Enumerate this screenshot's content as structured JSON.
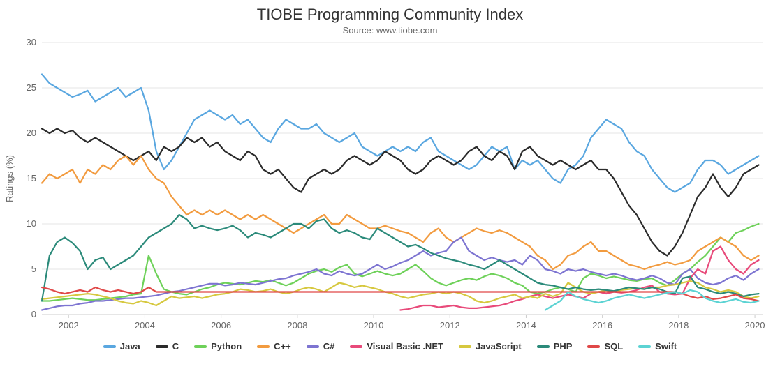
{
  "title": "TIOBE Programming Community Index",
  "subtitle": "Source: www.tiobe.com",
  "ylabel": "Ratings (%)",
  "chart_data": {
    "type": "line",
    "xlabel": "",
    "ylabel": "Ratings (%)",
    "ylim": [
      0,
      30
    ],
    "xlim": [
      2001.3,
      2020.2
    ],
    "xticks": [
      2002,
      2004,
      2006,
      2008,
      2010,
      2012,
      2014,
      2016,
      2018,
      2020
    ],
    "yticks": [
      0,
      5,
      10,
      15,
      20,
      25,
      30
    ],
    "x": [
      2001.3,
      2001.5,
      2001.7,
      2001.9,
      2002.1,
      2002.3,
      2002.5,
      2002.7,
      2002.9,
      2003.1,
      2003.3,
      2003.5,
      2003.7,
      2003.9,
      2004.1,
      2004.3,
      2004.5,
      2004.7,
      2004.9,
      2005.1,
      2005.3,
      2005.5,
      2005.7,
      2005.9,
      2006.1,
      2006.3,
      2006.5,
      2006.7,
      2006.9,
      2007.1,
      2007.3,
      2007.5,
      2007.7,
      2007.9,
      2008.1,
      2008.3,
      2008.5,
      2008.7,
      2008.9,
      2009.1,
      2009.3,
      2009.5,
      2009.7,
      2009.9,
      2010.1,
      2010.3,
      2010.5,
      2010.7,
      2010.9,
      2011.1,
      2011.3,
      2011.5,
      2011.7,
      2011.9,
      2012.1,
      2012.3,
      2012.5,
      2012.7,
      2012.9,
      2013.1,
      2013.3,
      2013.5,
      2013.7,
      2013.9,
      2014.1,
      2014.3,
      2014.5,
      2014.7,
      2014.9,
      2015.1,
      2015.3,
      2015.5,
      2015.7,
      2015.9,
      2016.1,
      2016.3,
      2016.5,
      2016.7,
      2016.9,
      2017.1,
      2017.3,
      2017.5,
      2017.7,
      2017.9,
      2018.1,
      2018.3,
      2018.5,
      2018.7,
      2018.9,
      2019.1,
      2019.3,
      2019.5,
      2019.7,
      2019.9,
      2020.1
    ],
    "series": [
      {
        "name": "Java",
        "color": "#5aa7e0",
        "values": [
          26.5,
          25.5,
          25.0,
          24.5,
          24.0,
          24.3,
          24.7,
          23.5,
          24.0,
          24.5,
          25.0,
          24.0,
          24.5,
          25.0,
          22.5,
          18.0,
          16.0,
          17.0,
          18.5,
          20.0,
          21.5,
          22.0,
          22.5,
          22.0,
          21.5,
          22.0,
          21.0,
          21.5,
          20.5,
          19.5,
          19.0,
          20.5,
          21.5,
          21.0,
          20.5,
          20.5,
          21.0,
          20.0,
          19.5,
          19.0,
          19.5,
          20.0,
          18.5,
          18.0,
          17.5,
          18.0,
          18.5,
          18.0,
          18.5,
          18.0,
          19.0,
          19.5,
          18.0,
          17.5,
          17.0,
          16.5,
          16.0,
          16.5,
          17.5,
          18.5,
          18.0,
          18.5,
          16.0,
          17.0,
          16.5,
          17.0,
          16.0,
          15.0,
          14.5,
          16.0,
          16.5,
          17.5,
          19.5,
          20.5,
          21.5,
          21.0,
          20.5,
          19.0,
          18.0,
          17.5,
          16.0,
          15.0,
          14.0,
          13.5,
          14.0,
          14.5,
          16.0,
          17.0,
          17.0,
          16.5,
          15.5,
          16.0,
          16.5,
          17.0,
          17.5
        ]
      },
      {
        "name": "C",
        "color": "#2b2b2b",
        "values": [
          20.5,
          20.0,
          20.5,
          20.0,
          20.3,
          19.5,
          19.0,
          19.5,
          19.0,
          18.5,
          18.0,
          17.5,
          17.0,
          17.5,
          18.0,
          17.0,
          18.5,
          18.0,
          18.5,
          19.5,
          19.0,
          19.5,
          18.5,
          19.0,
          18.0,
          17.5,
          17.0,
          18.0,
          17.5,
          16.0,
          15.5,
          16.0,
          15.0,
          14.0,
          13.5,
          15.0,
          15.5,
          16.0,
          15.5,
          16.0,
          17.0,
          17.5,
          17.0,
          16.5,
          17.0,
          18.0,
          17.5,
          17.0,
          16.0,
          15.5,
          16.0,
          17.0,
          17.5,
          17.0,
          16.5,
          17.0,
          18.0,
          18.5,
          17.5,
          17.0,
          18.0,
          17.5,
          16.0,
          18.0,
          18.5,
          17.5,
          17.0,
          16.5,
          17.0,
          16.5,
          16.0,
          16.5,
          17.0,
          16.0,
          16.0,
          15.0,
          13.5,
          12.0,
          11.0,
          9.5,
          8.0,
          7.0,
          6.5,
          7.5,
          9.0,
          11.0,
          13.0,
          14.0,
          15.5,
          14.0,
          13.0,
          14.0,
          15.5,
          16.0,
          16.5
        ]
      },
      {
        "name": "Python",
        "color": "#6ed159",
        "values": [
          1.5,
          1.5,
          1.6,
          1.7,
          1.8,
          1.7,
          1.6,
          1.6,
          1.7,
          1.8,
          1.9,
          2.0,
          2.2,
          2.3,
          6.5,
          4.5,
          2.8,
          2.5,
          2.3,
          2.2,
          2.5,
          2.8,
          3.0,
          3.3,
          3.5,
          3.4,
          3.3,
          3.5,
          3.7,
          3.6,
          3.8,
          3.5,
          3.2,
          3.5,
          4.0,
          4.5,
          4.8,
          5.0,
          4.7,
          5.2,
          5.5,
          4.5,
          4.2,
          4.5,
          4.8,
          4.5,
          4.3,
          4.5,
          5.0,
          5.5,
          4.8,
          4.0,
          3.5,
          3.2,
          3.5,
          3.8,
          4.0,
          3.8,
          4.2,
          4.5,
          4.3,
          4.0,
          3.5,
          3.2,
          2.5,
          2.3,
          2.5,
          2.8,
          3.0,
          2.8,
          2.5,
          4.0,
          4.5,
          4.3,
          4.0,
          4.2,
          4.0,
          3.8,
          3.7,
          3.9,
          4.0,
          3.5,
          3.2,
          3.8,
          4.5,
          5.0,
          5.8,
          6.5,
          7.5,
          8.5,
          8.0,
          9.0,
          9.3,
          9.7,
          10.0
        ]
      },
      {
        "name": "C++",
        "color": "#f29b3f",
        "values": [
          14.5,
          15.5,
          15.0,
          15.5,
          16.0,
          14.5,
          16.0,
          15.5,
          16.5,
          16.0,
          17.0,
          17.5,
          16.5,
          17.5,
          16.0,
          15.0,
          14.5,
          13.0,
          12.0,
          11.0,
          11.5,
          11.0,
          11.5,
          11.0,
          11.5,
          11.0,
          10.5,
          11.0,
          10.5,
          11.0,
          10.5,
          10.0,
          9.5,
          9.0,
          9.5,
          10.0,
          10.5,
          11.0,
          10.0,
          10.0,
          11.0,
          10.5,
          10.0,
          9.5,
          9.5,
          9.8,
          9.5,
          9.2,
          9.0,
          8.5,
          8.0,
          9.0,
          9.5,
          8.5,
          8.0,
          8.5,
          9.0,
          9.5,
          9.2,
          9.0,
          9.3,
          9.0,
          8.5,
          8.0,
          7.5,
          6.5,
          6.0,
          5.0,
          5.5,
          6.5,
          6.8,
          7.5,
          8.0,
          7.0,
          7.0,
          6.5,
          6.0,
          5.5,
          5.3,
          5.0,
          5.3,
          5.5,
          5.8,
          5.5,
          5.7,
          6.0,
          7.0,
          7.5,
          8.0,
          8.5,
          8.0,
          7.5,
          6.5,
          6.0,
          6.5
        ]
      },
      {
        "name": "C#",
        "color": "#7d74d1",
        "values": [
          0.5,
          0.7,
          0.9,
          1.0,
          1.0,
          1.2,
          1.3,
          1.5,
          1.5,
          1.6,
          1.7,
          1.8,
          1.8,
          1.9,
          2.0,
          2.1,
          2.3,
          2.5,
          2.6,
          2.8,
          3.0,
          3.2,
          3.4,
          3.4,
          3.2,
          3.3,
          3.5,
          3.4,
          3.3,
          3.5,
          3.7,
          3.9,
          4.0,
          4.3,
          4.5,
          4.7,
          5.0,
          4.5,
          4.3,
          4.8,
          4.5,
          4.3,
          4.5,
          5.0,
          5.5,
          5.0,
          5.3,
          5.7,
          6.0,
          6.5,
          7.0,
          6.5,
          6.8,
          7.0,
          8.0,
          8.5,
          7.0,
          6.5,
          6.0,
          6.3,
          6.0,
          5.8,
          6.0,
          5.5,
          6.5,
          6.0,
          5.0,
          4.8,
          4.5,
          5.0,
          4.8,
          5.0,
          4.7,
          4.5,
          4.3,
          4.5,
          4.3,
          4.0,
          3.8,
          4.0,
          4.3,
          4.0,
          3.5,
          3.3,
          4.5,
          5.0,
          4.0,
          3.5,
          3.3,
          3.5,
          4.0,
          4.3,
          3.8,
          4.5,
          5.0
        ]
      },
      {
        "name": "Visual Basic .NET",
        "color": "#e84a7a",
        "values": [
          null,
          null,
          null,
          null,
          null,
          null,
          null,
          null,
          null,
          null,
          null,
          null,
          null,
          null,
          null,
          null,
          null,
          null,
          null,
          null,
          null,
          null,
          null,
          null,
          null,
          null,
          null,
          null,
          null,
          null,
          null,
          null,
          null,
          null,
          null,
          null,
          null,
          null,
          null,
          null,
          null,
          null,
          null,
          null,
          null,
          null,
          null,
          0.5,
          0.6,
          0.8,
          1.0,
          1.0,
          0.8,
          0.9,
          1.0,
          0.8,
          0.7,
          0.7,
          0.8,
          0.9,
          1.0,
          1.2,
          1.5,
          1.7,
          2.0,
          2.2,
          2.0,
          1.8,
          2.0,
          2.2,
          2.0,
          1.8,
          2.3,
          2.5,
          2.3,
          2.5,
          2.4,
          2.5,
          2.7,
          3.0,
          3.2,
          2.5,
          2.3,
          2.2,
          2.3,
          4.0,
          5.0,
          4.5,
          7.0,
          7.5,
          6.0,
          5.0,
          4.5,
          5.5,
          6.0
        ]
      },
      {
        "name": "JavaScript",
        "color": "#d6c83f",
        "values": [
          1.7,
          1.8,
          1.9,
          2.0,
          2.1,
          2.2,
          2.3,
          2.2,
          2.0,
          1.8,
          1.5,
          1.3,
          1.2,
          1.5,
          1.3,
          1.0,
          1.5,
          2.0,
          1.8,
          1.9,
          2.0,
          1.8,
          2.0,
          2.2,
          2.3,
          2.5,
          2.8,
          2.7,
          2.5,
          2.6,
          2.8,
          2.5,
          2.3,
          2.5,
          2.8,
          3.0,
          2.8,
          2.5,
          3.0,
          3.5,
          3.3,
          3.0,
          3.2,
          3.0,
          2.8,
          2.5,
          2.3,
          2.0,
          1.8,
          2.0,
          2.2,
          2.3,
          2.5,
          2.3,
          2.5,
          2.3,
          2.0,
          1.5,
          1.3,
          1.5,
          1.8,
          2.0,
          2.2,
          1.8,
          2.0,
          1.8,
          2.3,
          2.0,
          2.3,
          3.5,
          3.0,
          2.5,
          2.3,
          2.5,
          2.7,
          2.5,
          2.7,
          2.8,
          2.9,
          2.8,
          3.0,
          3.0,
          3.2,
          3.3,
          3.5,
          3.7,
          3.5,
          3.0,
          2.8,
          2.5,
          2.7,
          2.5,
          2.0,
          1.8,
          2.0
        ]
      },
      {
        "name": "PHP",
        "color": "#2b8a7a",
        "values": [
          1.5,
          6.5,
          8.0,
          8.5,
          7.9,
          7.0,
          5.0,
          6.0,
          6.3,
          5.0,
          5.5,
          6.0,
          6.5,
          7.5,
          8.5,
          9.0,
          9.5,
          10.0,
          11.0,
          10.5,
          9.5,
          9.8,
          9.5,
          9.3,
          9.5,
          9.8,
          9.3,
          8.5,
          9.0,
          8.8,
          8.5,
          9.0,
          9.5,
          10.0,
          10.0,
          9.5,
          10.3,
          10.5,
          9.5,
          9.0,
          9.3,
          9.0,
          8.5,
          8.3,
          9.5,
          9.0,
          8.5,
          8.0,
          7.5,
          7.7,
          7.3,
          6.8,
          6.5,
          6.2,
          6.0,
          5.8,
          5.5,
          5.3,
          5.0,
          5.5,
          6.0,
          5.5,
          5.0,
          4.5,
          4.0,
          3.5,
          3.3,
          3.2,
          3.0,
          2.8,
          3.0,
          2.8,
          2.7,
          2.8,
          2.7,
          2.6,
          2.8,
          3.0,
          2.9,
          2.8,
          3.0,
          2.8,
          2.5,
          2.3,
          4.0,
          4.2,
          3.0,
          2.8,
          2.5,
          2.3,
          2.5,
          2.3,
          2.0,
          2.2,
          2.3
        ]
      },
      {
        "name": "SQL",
        "color": "#e04848",
        "values": [
          3.0,
          2.8,
          2.5,
          2.3,
          2.5,
          2.7,
          2.5,
          3.0,
          2.7,
          2.5,
          2.7,
          2.5,
          2.3,
          2.5,
          3.0,
          2.5,
          2.5,
          2.5,
          2.5,
          2.5,
          2.5,
          2.5,
          2.5,
          2.5,
          2.5,
          2.5,
          2.5,
          2.5,
          2.5,
          2.5,
          2.5,
          2.5,
          2.5,
          2.5,
          2.5,
          2.5,
          2.5,
          2.5,
          2.5,
          2.5,
          2.5,
          2.5,
          2.5,
          2.5,
          2.5,
          2.5,
          2.5,
          2.5,
          2.5,
          2.5,
          2.5,
          2.5,
          2.5,
          2.5,
          2.5,
          2.5,
          2.5,
          2.5,
          2.5,
          2.5,
          2.5,
          2.5,
          2.5,
          2.5,
          2.5,
          2.5,
          2.5,
          2.5,
          2.5,
          2.5,
          2.5,
          2.5,
          2.5,
          2.5,
          2.5,
          2.5,
          2.5,
          2.5,
          2.5,
          2.5,
          2.5,
          2.5,
          2.5,
          2.5,
          2.3,
          2.0,
          1.8,
          2.0,
          1.7,
          1.8,
          2.0,
          2.2,
          1.8,
          1.7,
          1.5
        ]
      },
      {
        "name": "Swift",
        "color": "#5cd3d3",
        "values": [
          null,
          null,
          null,
          null,
          null,
          null,
          null,
          null,
          null,
          null,
          null,
          null,
          null,
          null,
          null,
          null,
          null,
          null,
          null,
          null,
          null,
          null,
          null,
          null,
          null,
          null,
          null,
          null,
          null,
          null,
          null,
          null,
          null,
          null,
          null,
          null,
          null,
          null,
          null,
          null,
          null,
          null,
          null,
          null,
          null,
          null,
          null,
          null,
          null,
          null,
          null,
          null,
          null,
          null,
          null,
          null,
          null,
          null,
          null,
          null,
          null,
          null,
          null,
          null,
          null,
          null,
          0.5,
          1.0,
          1.5,
          2.5,
          2.0,
          1.7,
          1.5,
          1.3,
          1.5,
          1.8,
          2.0,
          2.2,
          2.0,
          1.8,
          2.0,
          2.2,
          2.4,
          2.5,
          2.3,
          2.7,
          2.5,
          1.8,
          1.5,
          1.3,
          1.5,
          1.7,
          1.4,
          1.3,
          1.5
        ]
      }
    ],
    "legend": [
      "Java",
      "C",
      "Python",
      "C++",
      "C#",
      "Visual Basic .NET",
      "JavaScript",
      "PHP",
      "SQL",
      "Swift"
    ]
  }
}
